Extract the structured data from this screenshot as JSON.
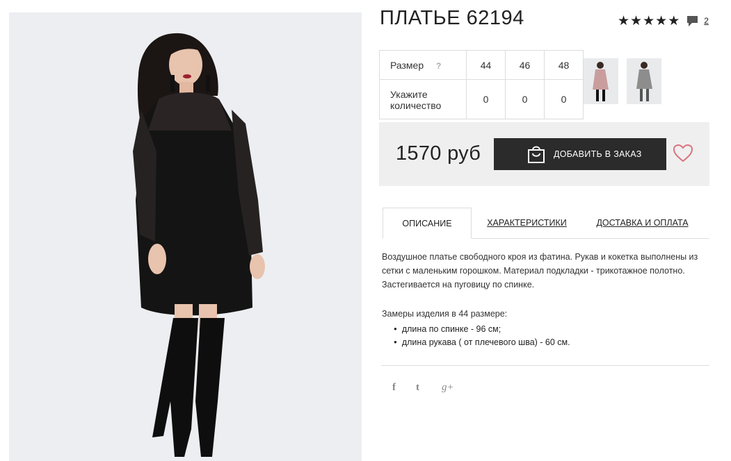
{
  "product": {
    "title": "ПЛАТЬЕ 62194",
    "rating_stars": 5,
    "comments_count": "2"
  },
  "sizes": {
    "label": "Размер",
    "help": "?",
    "values": [
      "44",
      "46",
      "48"
    ],
    "qty_label": "Укажите количество",
    "quantities": [
      "0",
      "0",
      "0"
    ]
  },
  "thumbnails": [
    {
      "name": "pink-dress-thumbnail",
      "color": "#c99d9e"
    },
    {
      "name": "grey-dress-thumbnail",
      "color": "#8d8d8d"
    }
  ],
  "price": {
    "value": "1570 руб",
    "add_button": "ДОБАВИТЬ В ЗАКАЗ"
  },
  "tabs": [
    {
      "label": "ОПИСАНИЕ",
      "active": true
    },
    {
      "label": "ХАРАКТЕРИСТИКИ",
      "active": false
    },
    {
      "label": "ДОСТАВКА И ОПЛАТА",
      "active": false
    }
  ],
  "description": {
    "text": "Воздушное платье свободного кроя из фатина. Рукав и кокетка выполнены из сетки с маленьким горошком. Материал подкладки - трикотажное полотно. Застегивается на пуговицу по спинке.",
    "measure_title": "Замеры изделия в 44 размере:",
    "measures": [
      "длина по спинке - 96 см;",
      "длина рукава ( от плечевого шва) - 60 см."
    ]
  },
  "social": [
    "f",
    "t",
    "g+"
  ],
  "colors": {
    "button_bg": "#2b2b2b",
    "price_bg": "#efefef",
    "heart": "#d9737f"
  }
}
